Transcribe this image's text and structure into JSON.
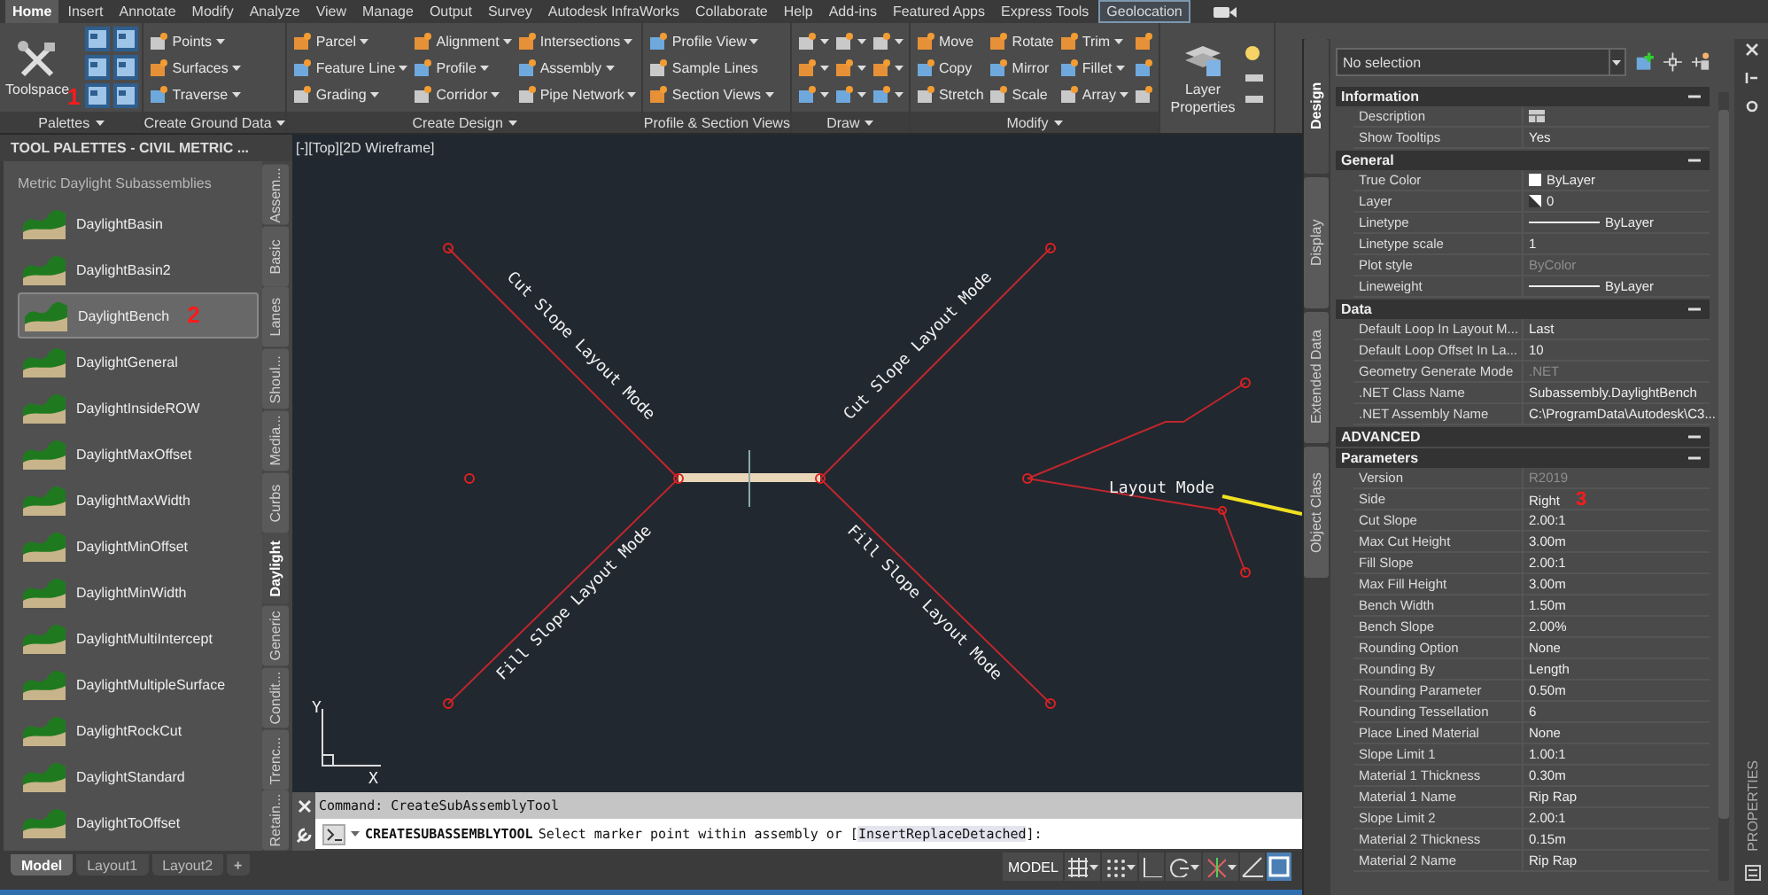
{
  "menu_tabs": [
    {
      "label": "Home",
      "selected": true,
      "contextual": false
    },
    {
      "label": "Insert",
      "selected": false,
      "contextual": false
    },
    {
      "label": "Annotate",
      "selected": false,
      "contextual": false
    },
    {
      "label": "Modify",
      "selected": false,
      "contextual": false
    },
    {
      "label": "Analyze",
      "selected": false,
      "contextual": false
    },
    {
      "label": "View",
      "selected": false,
      "contextual": false
    },
    {
      "label": "Manage",
      "selected": false,
      "contextual": false
    },
    {
      "label": "Output",
      "selected": false,
      "contextual": false
    },
    {
      "label": "Survey",
      "selected": false,
      "contextual": false
    },
    {
      "label": "Autodesk InfraWorks",
      "selected": false,
      "contextual": false
    },
    {
      "label": "Collaborate",
      "selected": false,
      "contextual": false
    },
    {
      "label": "Help",
      "selected": false,
      "contextual": false
    },
    {
      "label": "Add-ins",
      "selected": false,
      "contextual": false
    },
    {
      "label": "Featured Apps",
      "selected": false,
      "contextual": false
    },
    {
      "label": "Express Tools",
      "selected": false,
      "contextual": false
    },
    {
      "label": "Geolocation",
      "selected": false,
      "contextual": true
    }
  ],
  "ribbon": [
    {
      "kind": "palettes",
      "title": "Palettes",
      "menu": true,
      "big_button": "Toolspace",
      "marker": "1"
    },
    {
      "kind": "tools",
      "title": "Create Ground Data",
      "menu": true,
      "tools": [
        {
          "label": "Points",
          "dropdown": true
        },
        {
          "label": "Surfaces",
          "dropdown": true
        },
        {
          "label": "Traverse",
          "dropdown": true
        }
      ]
    },
    {
      "kind": "tools",
      "title": "Create Design",
      "menu": true,
      "tools": [
        {
          "label": "Parcel",
          "dropdown": true
        },
        {
          "label": "Feature Line",
          "dropdown": true
        },
        {
          "label": "Grading",
          "dropdown": true
        },
        {
          "label": "Alignment",
          "dropdown": true
        },
        {
          "label": "Profile",
          "dropdown": true
        },
        {
          "label": "Corridor",
          "dropdown": true
        },
        {
          "label": "Intersections",
          "dropdown": true
        },
        {
          "label": "Assembly",
          "dropdown": true
        },
        {
          "label": "Pipe Network",
          "dropdown": true
        }
      ]
    },
    {
      "kind": "tools",
      "title": "Profile & Section Views",
      "menu": false,
      "tools": [
        {
          "label": "Profile View",
          "dropdown": true
        },
        {
          "label": "Sample Lines",
          "dropdown": false
        },
        {
          "label": "Section Views",
          "dropdown": true
        }
      ]
    },
    {
      "kind": "tools",
      "title": "Draw",
      "menu": true,
      "tools": [
        {
          "dropdown": true
        },
        {
          "dropdown": true
        },
        {
          "dropdown": true
        },
        {
          "dropdown": true
        },
        {
          "dropdown": true
        },
        {
          "dropdown": true
        },
        {
          "dropdown": true
        },
        {
          "dropdown": true
        },
        {
          "dropdown": true
        }
      ]
    },
    {
      "kind": "tools",
      "title": "Modify",
      "menu": true,
      "tools": [
        {
          "label": "Move",
          "dropdown": false
        },
        {
          "label": "Copy",
          "dropdown": false
        },
        {
          "label": "Stretch",
          "dropdown": false
        },
        {
          "label": "Rotate",
          "dropdown": false
        },
        {
          "label": "Mirror",
          "dropdown": false
        },
        {
          "label": "Scale",
          "dropdown": false
        },
        {
          "label": "Trim",
          "dropdown": true
        },
        {
          "label": "Fillet",
          "dropdown": true
        },
        {
          "label": "Array",
          "dropdown": true
        },
        {
          "dropdown": false
        },
        {
          "dropdown": false
        },
        {
          "dropdown": false
        }
      ]
    },
    {
      "kind": "layer",
      "big_button": "Layer Properties"
    }
  ],
  "palette": {
    "title": "TOOL PALETTES - CIVIL METRIC ...",
    "group": "Metric Daylight Subassemblies",
    "items": [
      {
        "label": "DaylightBasin",
        "selected": false
      },
      {
        "label": "DaylightBasin2",
        "selected": false
      },
      {
        "label": "DaylightBench",
        "selected": true,
        "marker": "2"
      },
      {
        "label": "DaylightGeneral",
        "selected": false
      },
      {
        "label": "DaylightInsideROW",
        "selected": false
      },
      {
        "label": "DaylightMaxOffset",
        "selected": false
      },
      {
        "label": "DaylightMaxWidth",
        "selected": false
      },
      {
        "label": "DaylightMinOffset",
        "selected": false
      },
      {
        "label": "DaylightMinWidth",
        "selected": false
      },
      {
        "label": "DaylightMultiIntercept",
        "selected": false
      },
      {
        "label": "DaylightMultipleSurface",
        "selected": false
      },
      {
        "label": "DaylightRockCut",
        "selected": false
      },
      {
        "label": "DaylightStandard",
        "selected": false
      },
      {
        "label": "DaylightToOffset",
        "selected": false
      }
    ],
    "tabs": [
      {
        "label": "Assem...",
        "selected": false
      },
      {
        "label": "Basic",
        "selected": false
      },
      {
        "label": "Lanes",
        "selected": false
      },
      {
        "label": "Shoul...",
        "selected": false
      },
      {
        "label": "Media...",
        "selected": false
      },
      {
        "label": "Curbs",
        "selected": false
      },
      {
        "label": "Daylight",
        "selected": true
      },
      {
        "label": "Generic",
        "selected": false
      },
      {
        "label": "Condit...",
        "selected": false
      },
      {
        "label": "Trenc...",
        "selected": false
      },
      {
        "label": "Retain...",
        "selected": false
      }
    ]
  },
  "viewport": {
    "label": "[-][Top][2D Wireframe]",
    "labels": [
      "Cut Slope Layout Mode",
      "Cut Slope Layout Mode",
      "Fill Slope Layout Mode",
      "Fill Slope Layout Mode",
      "Layout Mode"
    ],
    "axis_x": "X",
    "axis_y": "Y"
  },
  "command": {
    "history": "Command: CreateSubAssemblyTool",
    "name": "CREATESUBASSEMBLYTOOL",
    "prompt": "Select marker point within assembly or [",
    "options": [
      "Insert",
      "Replace",
      "Detached"
    ],
    "prompt_end": "]:"
  },
  "layout_tabs": [
    {
      "label": "Model",
      "selected": true
    },
    {
      "label": "Layout1",
      "selected": false
    },
    {
      "label": "Layout2",
      "selected": false
    }
  ],
  "add_tab": "+",
  "status_bar": {
    "model_button": "MODEL"
  },
  "properties": {
    "selection": "No selection",
    "title": "PROPERTIES",
    "tabs": [
      {
        "label": "Design",
        "selected": true
      },
      {
        "label": "Display",
        "selected": false
      },
      {
        "label": "Extended Data",
        "selected": false
      },
      {
        "label": "Object Class",
        "selected": false
      }
    ],
    "sections": [
      {
        "title": "Information",
        "expanded": true,
        "rows": [
          {
            "label": "Description",
            "kind": "icon",
            "disabled": false
          },
          {
            "label": "Show Tooltips",
            "value": "Yes",
            "disabled": false
          }
        ]
      },
      {
        "title": "General",
        "expanded": true,
        "rows": [
          {
            "label": "True Color",
            "value": "ByLayer",
            "kind": "swatch",
            "disabled": false
          },
          {
            "label": "Layer",
            "value": "0",
            "kind": "layer",
            "disabled": false
          },
          {
            "label": "Linetype",
            "value": "ByLayer",
            "kind": "line",
            "disabled": false
          },
          {
            "label": "Linetype scale",
            "value": "1",
            "disabled": false
          },
          {
            "label": "Plot style",
            "value": "ByColor",
            "disabled": true
          },
          {
            "label": "Lineweight",
            "value": "ByLayer",
            "kind": "line",
            "disabled": false
          }
        ]
      },
      {
        "title": "Data",
        "expanded": true,
        "rows": [
          {
            "label": "Default Loop In Layout M...",
            "value": "Last",
            "disabled": false
          },
          {
            "label": "Default Loop Offset In La...",
            "value": "10",
            "disabled": false
          },
          {
            "label": "Geometry Generate Mode",
            "value": ".NET",
            "disabled": true
          },
          {
            "label": ".NET Class Name",
            "value": "Subassembly.DaylightBench",
            "disabled": false
          },
          {
            "label": ".NET Assembly Name",
            "value": "C:\\ProgramData\\Autodesk\\C3...",
            "disabled": false
          }
        ]
      },
      {
        "title": "ADVANCED",
        "expanded": true,
        "subsections": [
          {
            "title": "Parameters",
            "expanded": true,
            "rows": [
              {
                "label": "Version",
                "value": "R2019",
                "disabled": true
              },
              {
                "label": "Side",
                "value": "Right",
                "disabled": false,
                "marker": "3"
              },
              {
                "label": "Cut Slope",
                "value": "2.00:1",
                "disabled": false
              },
              {
                "label": "Max Cut Height",
                "value": "3.00m",
                "disabled": false
              },
              {
                "label": "Fill Slope",
                "value": "2.00:1",
                "disabled": false
              },
              {
                "label": "Max Fill Height",
                "value": "3.00m",
                "disabled": false
              },
              {
                "label": "Bench Width",
                "value": "1.50m",
                "disabled": false
              },
              {
                "label": "Bench Slope",
                "value": "2.00%",
                "disabled": false
              },
              {
                "label": "Rounding Option",
                "value": "None",
                "disabled": false
              },
              {
                "label": "Rounding By",
                "value": "Length",
                "disabled": false
              },
              {
                "label": "Rounding Parameter",
                "value": "0.50m",
                "disabled": false
              },
              {
                "label": "Rounding Tessellation",
                "value": "6",
                "disabled": false
              },
              {
                "label": "Place Lined Material",
                "value": "None",
                "disabled": false
              },
              {
                "label": "Slope Limit 1",
                "value": "1.00:1",
                "disabled": false
              },
              {
                "label": "Material 1 Thickness",
                "value": "0.30m",
                "disabled": false
              },
              {
                "label": "Material 1 Name",
                "value": "Rip Rap",
                "disabled": false
              },
              {
                "label": "Slope Limit 2",
                "value": "2.00:1",
                "disabled": false
              },
              {
                "label": "Material 2 Thickness",
                "value": "0.15m",
                "disabled": false
              },
              {
                "label": "Material 2 Name",
                "value": "Rip Rap",
                "disabled": false
              }
            ]
          }
        ]
      }
    ]
  }
}
